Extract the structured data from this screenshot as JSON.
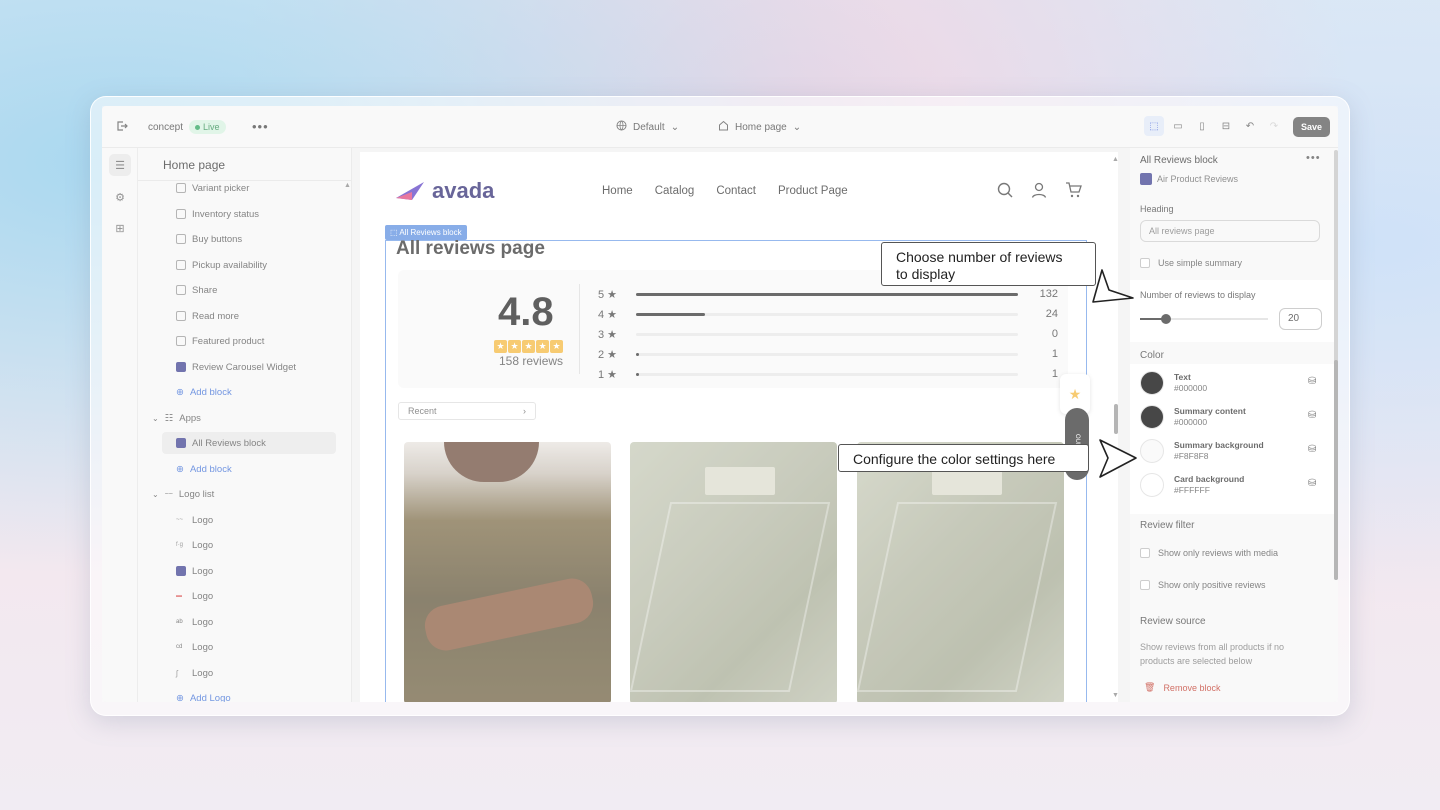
{
  "topbar": {
    "store_name": "concept",
    "status": "Live",
    "theme": "Default",
    "page": "Home page",
    "save_label": "Save"
  },
  "left_panel": {
    "title": "Home page",
    "items": [
      {
        "label": "Variant picker"
      },
      {
        "label": "Inventory status"
      },
      {
        "label": "Buy buttons"
      },
      {
        "label": "Pickup availability"
      },
      {
        "label": "Share"
      },
      {
        "label": "Read more"
      },
      {
        "label": "Featured product"
      },
      {
        "label": "Review Carousel Widget"
      },
      {
        "label": "Add block"
      },
      {
        "label": "Apps"
      },
      {
        "label": "All Reviews block"
      },
      {
        "label": "Add block"
      },
      {
        "label": "Logo list"
      },
      {
        "label": "Logo"
      },
      {
        "label": "Logo"
      },
      {
        "label": "Logo"
      },
      {
        "label": "Logo"
      },
      {
        "label": "Logo"
      },
      {
        "label": "Logo"
      },
      {
        "label": "Logo"
      },
      {
        "label": "Add Logo"
      }
    ]
  },
  "store": {
    "logo_text": "avada",
    "menu": [
      "Home",
      "Catalog",
      "Contact",
      "Product Page"
    ]
  },
  "reviews": {
    "block_tag": "All Reviews block",
    "title": "All reviews page",
    "rating": "4.8",
    "stars_shown": 5,
    "count_label": "158 reviews",
    "distribution": [
      {
        "label": "5 ★",
        "count": 132,
        "count_label": "132"
      },
      {
        "label": "4 ★",
        "count": 24,
        "count_label": "24"
      },
      {
        "label": "3 ★",
        "count": 0,
        "count_label": "0"
      },
      {
        "label": "2 ★",
        "count": 1,
        "count_label": "1"
      },
      {
        "label": "1 ★",
        "count": 1,
        "count_label": "1"
      }
    ],
    "sort_label": "Recent",
    "side_tab_text": "OUR R"
  },
  "right_panel": {
    "block_title": "All Reviews block",
    "app_name": "Air Product Reviews",
    "heading_label": "Heading",
    "heading_value": "All reviews page",
    "simple_summary_label": "Use simple summary",
    "num_reviews_label": "Number of reviews to display",
    "num_reviews_value": "20",
    "slider_level": 0.2,
    "color_section": "Color",
    "colors": [
      {
        "name": "Text",
        "value": "#000000",
        "swatch": "#000000"
      },
      {
        "name": "Summary content",
        "value": "#000000",
        "swatch": "#000000"
      },
      {
        "name": "Summary background",
        "value": "#F8F8F8",
        "swatch": "#F8F8F8"
      },
      {
        "name": "Card background",
        "value": "#FFFFFF",
        "swatch": "#FFFFFF"
      }
    ],
    "filter_section": "Review filter",
    "filter_media": "Show only reviews with media",
    "filter_positive": "Show only positive reviews",
    "source_section": "Review source",
    "source_desc_1": "Show reviews from all products if no",
    "source_desc_2": "products are selected below",
    "remove_label": "Remove block"
  },
  "callouts": {
    "reviews_count_1": "Choose number of reviews",
    "reviews_count_2": "to display",
    "colors": "Configure the color settings here"
  }
}
